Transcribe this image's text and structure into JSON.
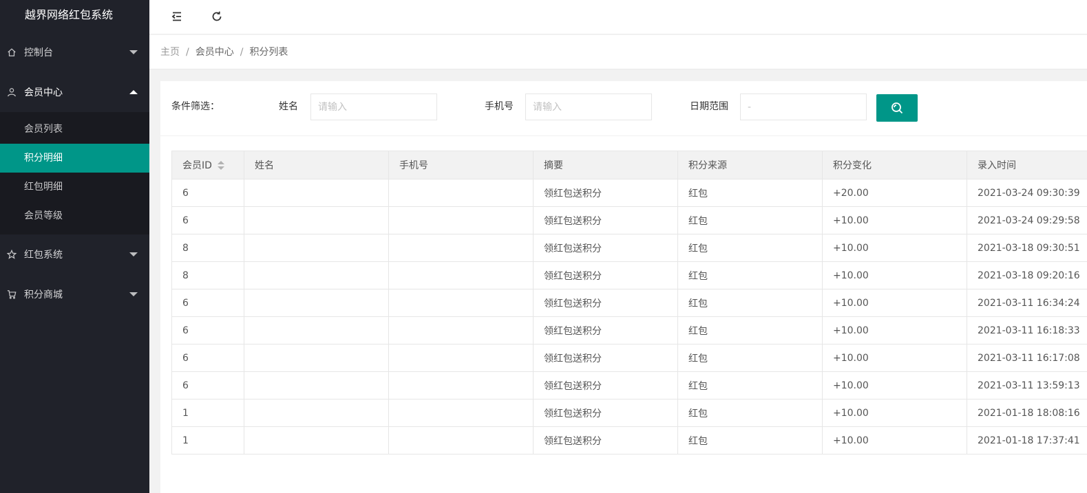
{
  "app": {
    "title": "越界网络红包系统"
  },
  "sidebar": {
    "groups": [
      {
        "label": "控制台",
        "icon": "home-icon",
        "expanded": false
      },
      {
        "label": "会员中心",
        "icon": "user-icon",
        "expanded": true,
        "items": [
          {
            "label": "会员列表"
          },
          {
            "label": "积分明细"
          },
          {
            "label": "红包明细"
          },
          {
            "label": "会员等级"
          }
        ],
        "selected": "积分明细"
      },
      {
        "label": "红包系统",
        "icon": "star-icon",
        "expanded": false
      },
      {
        "label": "积分商城",
        "icon": "cart-icon",
        "expanded": false
      }
    ]
  },
  "header": {
    "buttons": [
      "menu-collapse-icon",
      "refresh-icon"
    ]
  },
  "breadcrumb": [
    "主页",
    "会员中心",
    "积分列表"
  ],
  "filter": {
    "title": "条件筛选：",
    "name_label": "姓名",
    "name_placeholder": "请输入",
    "phone_label": "手机号",
    "phone_placeholder": "请输入",
    "date_label": "日期范围",
    "date_placeholder": "-",
    "search_icon": "search-icon",
    "accent": "#009688"
  },
  "table": {
    "columns": [
      "会员ID",
      "姓名",
      "手机号",
      "摘要",
      "积分来源",
      "积分变化",
      "录入时间"
    ],
    "rows": [
      {
        "id": "6",
        "name": "",
        "phone": "",
        "summary": "领红包送积分",
        "source": "红包",
        "change": "+20.00",
        "time": "2021-03-24 09:30:39"
      },
      {
        "id": "6",
        "name": "",
        "phone": "",
        "summary": "领红包送积分",
        "source": "红包",
        "change": "+10.00",
        "time": "2021-03-24 09:29:58"
      },
      {
        "id": "8",
        "name": "",
        "phone": "",
        "summary": "领红包送积分",
        "source": "红包",
        "change": "+10.00",
        "time": "2021-03-18 09:30:51"
      },
      {
        "id": "8",
        "name": "",
        "phone": "",
        "summary": "领红包送积分",
        "source": "红包",
        "change": "+10.00",
        "time": "2021-03-18 09:20:16"
      },
      {
        "id": "6",
        "name": "",
        "phone": "",
        "summary": "领红包送积分",
        "source": "红包",
        "change": "+10.00",
        "time": "2021-03-11 16:34:24"
      },
      {
        "id": "6",
        "name": "",
        "phone": "",
        "summary": "领红包送积分",
        "source": "红包",
        "change": "+10.00",
        "time": "2021-03-11 16:18:33"
      },
      {
        "id": "6",
        "name": "",
        "phone": "",
        "summary": "领红包送积分",
        "source": "红包",
        "change": "+10.00",
        "time": "2021-03-11 16:17:08"
      },
      {
        "id": "6",
        "name": "",
        "phone": "",
        "summary": "领红包送积分",
        "source": "红包",
        "change": "+10.00",
        "time": "2021-03-11 13:59:13"
      },
      {
        "id": "1",
        "name": "",
        "phone": "",
        "summary": "领红包送积分",
        "source": "红包",
        "change": "+10.00",
        "time": "2021-01-18 18:08:16"
      },
      {
        "id": "1",
        "name": "",
        "phone": "",
        "summary": "领红包送积分",
        "source": "红包",
        "change": "+10.00",
        "time": "2021-01-18 17:37:41"
      }
    ]
  }
}
